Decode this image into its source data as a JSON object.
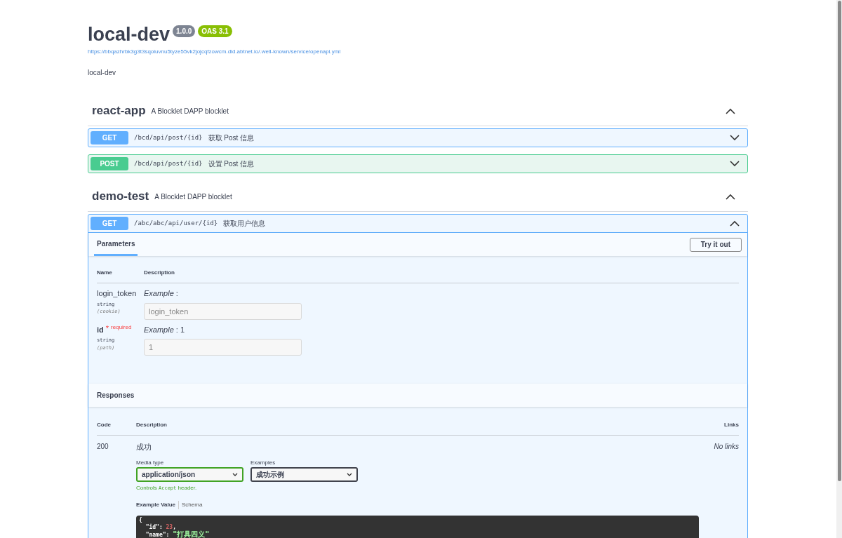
{
  "info": {
    "title": "local-dev",
    "version": "1.0.0",
    "oas": "OAS 3.1",
    "url": "https://bbqazhrbk3g3t3sqoiuvnu5tyze55vk2jojcqfzowcm.did.abtnet.io/.well-known/service/openapi.yml",
    "description": "local-dev"
  },
  "tags": [
    {
      "name": "react-app",
      "description": "A Blocklet DAPP blocklet",
      "expanded": true,
      "operations": [
        {
          "method": "GET",
          "path": "/bcd/api/post/{id}",
          "summary": "获取 Post 信息",
          "expanded": false
        },
        {
          "method": "POST",
          "path": "/bcd/api/post/{id}",
          "summary": "设置 Post 信息",
          "expanded": false
        }
      ]
    },
    {
      "name": "demo-test",
      "description": "A Blocklet DAPP blocklet",
      "expanded": true,
      "operations": [
        {
          "method": "GET",
          "path": "/abc/abc/api/user/{id}",
          "summary": "获取用户信息",
          "expanded": true
        }
      ]
    }
  ],
  "detail": {
    "section_tab": "Parameters",
    "try_button": "Try it out",
    "param_columns": [
      "Name",
      "Description"
    ],
    "parameters": [
      {
        "name": "login_token",
        "required": false,
        "type": "string",
        "location": "(cookie)",
        "example": "*Example* :",
        "placeholder": "login_token"
      },
      {
        "name": "id",
        "required": true,
        "required_mark": "*",
        "required_label": "required",
        "type": "string",
        "location": "(path)",
        "example": "*Example* : 1",
        "placeholder": "1"
      }
    ],
    "responses_title": "Responses",
    "response_columns": [
      "Code",
      "Description",
      "Links"
    ],
    "responses": [
      {
        "code": "200",
        "description": "成功",
        "links": "No links",
        "media_type_label": "Media type",
        "media_type": "application/json",
        "examples_label": "Examples",
        "example": "成功示例",
        "controls_note": [
          "Controls ",
          "Accept",
          " header."
        ],
        "value_tabs": [
          {
            "label": "Example Value",
            "selected": true
          },
          {
            "label": "Schema",
            "selected": false
          }
        ],
        "code_lines": [
          [
            {
              "kind": "punct",
              "text": "{"
            }
          ],
          [
            {
              "kind": "key",
              "text": "  \"id\""
            },
            {
              "kind": "punct",
              "text": ": "
            },
            {
              "kind": "number",
              "text": "23"
            },
            {
              "kind": "punct",
              "text": ","
            }
          ],
          [
            {
              "kind": "key",
              "text": "  \"name\""
            },
            {
              "kind": "punct",
              "text": ": "
            },
            {
              "kind": "string",
              "text": "\"打具四义\""
            }
          ]
        ]
      }
    ]
  }
}
